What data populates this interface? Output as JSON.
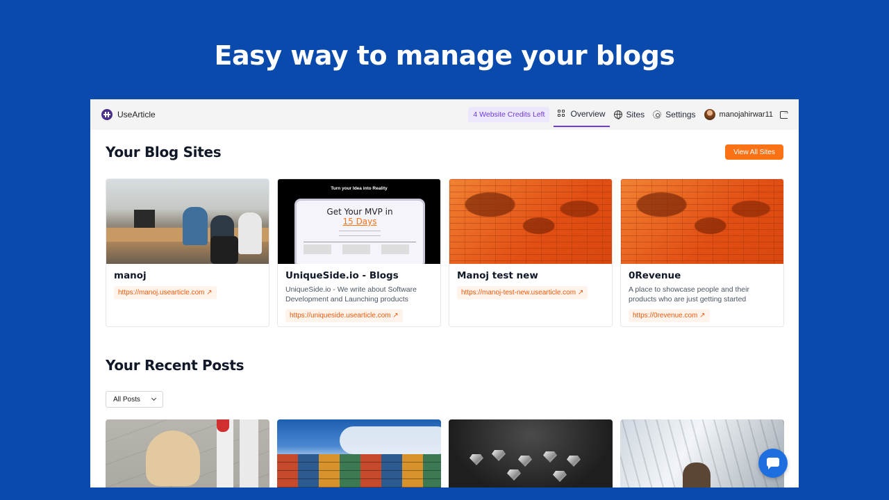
{
  "headline": "Easy way to manage your blogs",
  "app": {
    "brand": "UseArticle",
    "nav": {
      "credits": "4 Website Credits Left",
      "overview": "Overview",
      "sites": "Sites",
      "settings": "Settings",
      "username": "manojahirwar11"
    },
    "blog_section": {
      "title": "Your Blog Sites",
      "view_all": "View All Sites",
      "sites": [
        {
          "name": "manoj",
          "description": "",
          "url": "https://manoj.usearticle.com ↗"
        },
        {
          "name": "UniqueSide.io - Blogs",
          "description": "UniqueSide.io - We write about Software Development and Launching products",
          "url": "https://uniqueside.usearticle.com ↗",
          "thumb": {
            "top": "Turn your Idea into Reality",
            "heading": "Get Your MVP in",
            "highlight": "15 Days"
          }
        },
        {
          "name": "Manoj test new",
          "description": "",
          "url": "https://manoj-test-new.usearticle.com ↗"
        },
        {
          "name": "0Revenue",
          "description": "A place to showcase people and their products who are just getting started",
          "url": "https://0revenue.com ↗"
        }
      ]
    },
    "posts_section": {
      "title": "Your Recent Posts",
      "filter": "All Posts"
    }
  },
  "colors": {
    "background": "#0a4aad",
    "accent": "#f97316",
    "credits": "#6d3bd8",
    "chat": "#1d6fe0"
  }
}
